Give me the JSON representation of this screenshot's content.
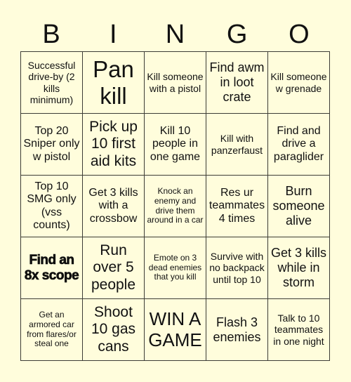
{
  "header": {
    "letters": [
      "B",
      "I",
      "N",
      "G",
      "O"
    ]
  },
  "grid": {
    "rows": [
      [
        {
          "text": "Successful drive-by (2 kills minimum)"
        },
        {
          "text": "Pan kill"
        },
        {
          "text": "Kill someone with a pistol"
        },
        {
          "text": "Find awm in loot crate"
        },
        {
          "text": "Kill someone w grenade"
        }
      ],
      [
        {
          "text": "Top 20 Sniper only w pistol"
        },
        {
          "text": "Pick up 10 first aid kits"
        },
        {
          "text": "Kill 10 people in one game"
        },
        {
          "text": "Kill with panzerfaust"
        },
        {
          "text": "Find and drive a paraglider"
        }
      ],
      [
        {
          "text": "Top 10 SMG only (vss counts)"
        },
        {
          "text": "Get 3 kills with a crossbow"
        },
        {
          "text": "Knock an enemy and drive them around in a car"
        },
        {
          "text": "Res ur teammates 4 times"
        },
        {
          "text": "Burn someone alive"
        }
      ],
      [
        {
          "text": "Find an 8x scope"
        },
        {
          "text": "Run over 5 people"
        },
        {
          "text": "Emote on 3 dead enemies that you kill"
        },
        {
          "text": "Survive with no backpack until top 10"
        },
        {
          "text": "Get 3 kills while in storm"
        }
      ],
      [
        {
          "text": "Get an armored car from flares/or steal one"
        },
        {
          "text": "Shoot 10 gas cans"
        },
        {
          "text": "WIN A GAME"
        },
        {
          "text": "Flash 3 enemies"
        },
        {
          "text": "Talk to 10 teammates in one night"
        }
      ]
    ]
  },
  "colors": {
    "background": "#fffddc",
    "border": "#3c3c36",
    "text": "#111111"
  }
}
